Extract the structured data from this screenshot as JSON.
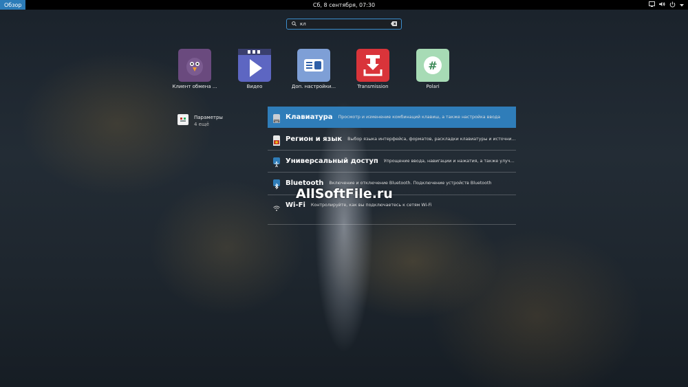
{
  "topbar": {
    "activities": "Обзор",
    "clock": "Сб, 8 сентября, 07:30",
    "icons": [
      "screen-icon",
      "volume-icon",
      "power-icon",
      "chevron-down-icon"
    ]
  },
  "search": {
    "value": "кл"
  },
  "apps": [
    {
      "label": "Клиент обмена ...",
      "icon": "pidgin-icon",
      "color": "#6a4a7e"
    },
    {
      "label": "Видео",
      "icon": "video-player-icon",
      "color": "#5d66c2"
    },
    {
      "label": "Доп. настройки...",
      "icon": "tweaks-icon",
      "color": "#7e9fd6"
    },
    {
      "label": "Transmission",
      "icon": "transmission-icon",
      "color": "#d9343a"
    },
    {
      "label": "Polari",
      "icon": "polari-icon",
      "color": "#a7dbb5"
    }
  ],
  "provider": {
    "name": "Параметры",
    "more": "4 ещё",
    "icon": "settings-app-icon"
  },
  "results": [
    {
      "title": "Клавиатура",
      "desc": "Просмотр и изменение комбинаций клавиш, а также настройка ввода",
      "icon": "keyboard-icon"
    },
    {
      "title": "Регион и язык",
      "desc": "Выбор языка интерфейса, форматов, раскладки клавиатуры и источник...",
      "icon": "region-flag-icon"
    },
    {
      "title": "Универсальный доступ",
      "desc": "Упрощение ввода, навигации и нажатия, а также улучшен...",
      "icon": "accessibility-icon"
    },
    {
      "title": "Bluetooth",
      "desc": "Включение и отключение Bluetooth. Подключение устройств Bluetooth",
      "icon": "bluetooth-icon"
    },
    {
      "title": "Wi-Fi",
      "desc": "Контролируйте, как вы подключаетесь к сетям Wi-Fi",
      "icon": "wifi-icon"
    }
  ],
  "watermark": "AllSoftFile.ru",
  "colors": {
    "accent": "#2f7db9",
    "topbar": "#000000"
  }
}
